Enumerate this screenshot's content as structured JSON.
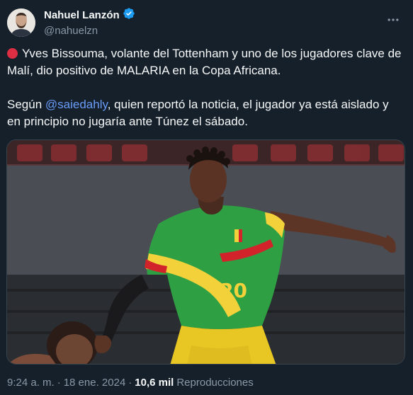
{
  "author": {
    "display_name": "Nahuel Lanzón",
    "handle": "@nahuelzn",
    "verified": true
  },
  "icons": {
    "verified": "verified-badge-icon",
    "more": "more-options-icon",
    "red_circle": "red-circle-emoji"
  },
  "colors": {
    "background": "#15202b",
    "accent": "#1d9bf0",
    "mention": "#6a9cf7",
    "secondary_text": "#8b98a5",
    "jersey_green": "#2ea043",
    "jersey_yellow": "#f2d13b",
    "jersey_red": "#d2232a"
  },
  "tweet": {
    "paragraph1": "Yves Bissouma, volante del Tottenham y uno de los jugadores clave de Malí, dio positivo de MALARIA en la Copa Africana.",
    "paragraph2_before": "Según ",
    "mention": "@saiedahly",
    "paragraph2_after": ", quien reportó la noticia, el jugador ya está aislado y en principio no jugaría ante Túnez el sábado."
  },
  "media": {
    "jersey_number": "20"
  },
  "footer": {
    "time": "9:24 a. m.",
    "separator": "·",
    "date": "18 ene. 2024",
    "views_count": "10,6 mil",
    "views_label": "Reproducciones"
  }
}
